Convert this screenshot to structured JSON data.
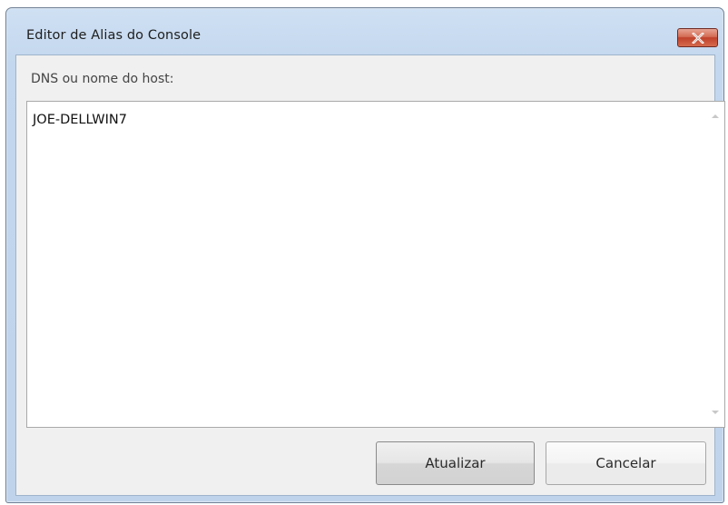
{
  "window": {
    "title": "Editor de Alias do Console"
  },
  "form": {
    "label": "DNS ou nome do host:",
    "host_value": "JOE-DELLWIN7"
  },
  "buttons": {
    "update": "Atualizar",
    "cancel": "Cancelar"
  },
  "icons": {
    "close": "close-icon",
    "scroll_up": "chevron-up-icon",
    "scroll_down": "chevron-down-icon"
  },
  "colors": {
    "titlebar": "#c3d7ee",
    "close_button": "#c9503a",
    "client_bg": "#f0f0f0"
  }
}
